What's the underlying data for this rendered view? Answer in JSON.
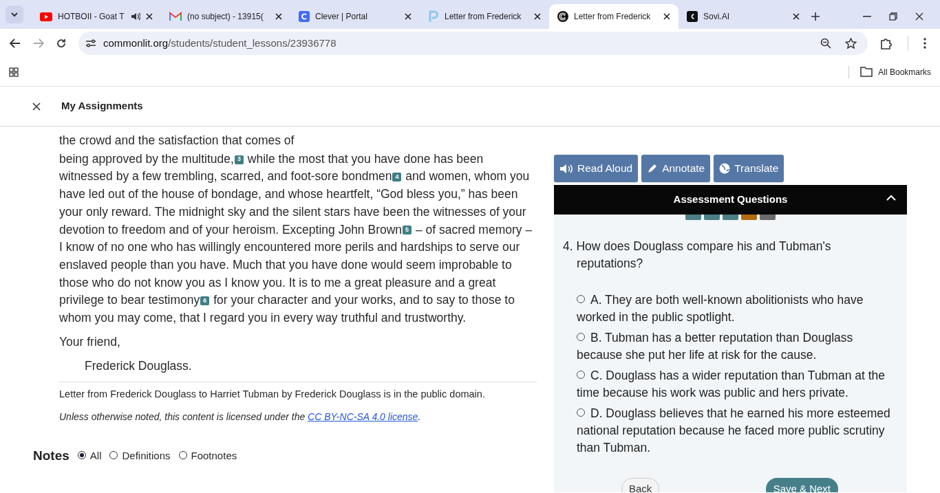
{
  "browser": {
    "tabs": [
      {
        "title": "HOTBOII - Goat T",
        "audio": true,
        "selected": false
      },
      {
        "title": "(no subject) - 13915(",
        "audio": false,
        "selected": false
      },
      {
        "title": "Clever | Portal",
        "audio": false,
        "selected": false
      },
      {
        "title": "Letter from Frederick",
        "audio": false,
        "selected": false
      },
      {
        "title": "Letter from Frederick",
        "audio": false,
        "selected": true
      },
      {
        "title": "Sovi.AI",
        "audio": false,
        "selected": false
      }
    ],
    "url_host": "commonlit.org",
    "url_path": "/students/student_lessons/23936778",
    "bookmarks_label": "All Bookmarks"
  },
  "header": {
    "title": "My Assignments"
  },
  "passage": {
    "lead_line": "the crowd and the satisfaction that comes of",
    "paragraph": [
      {
        "kind": "text",
        "text": "being approved by the multitude,"
      },
      {
        "kind": "footnote",
        "text": "3"
      },
      {
        "kind": "text",
        "text": " while the most that you have done has been witnessed by a few trembling, scarred, and foot-sore bondmen"
      },
      {
        "kind": "footnote",
        "text": "4"
      },
      {
        "kind": "text",
        "text": " and women, whom you have led out of the house of bondage, and whose heartfelt, “God bless you,” has been your only reward. The midnight sky and the silent stars have been the witnesses of your devotion to freedom and of your heroism. Excepting John Brown"
      },
      {
        "kind": "footnote",
        "text": "5"
      },
      {
        "kind": "text",
        "text": " – of sacred memory – I know of no one who has willingly encountered more perils and hardships to serve our enslaved people than you have. Much that you have done would seem improbable to those who do not know you as I know you. It is to me a great pleasure and a great privilege to bear testimony"
      },
      {
        "kind": "footnote",
        "text": "6"
      },
      {
        "kind": "text",
        "text": " for your character and your works, and to say to those to whom you may come, that I regard you in every way truthful and trustworthy."
      }
    ],
    "closing": "Your friend,",
    "signature": "Frederick Douglass.",
    "attribution": "Letter from Frederick Douglass to Harriet Tubman by Frederick Douglass is in the public domain.",
    "license_text": "Unless otherwise noted, this content is licensed under the",
    "license_link": "CC BY-NC-SA 4.0 license",
    "license_end": "."
  },
  "notes": {
    "title": "Notes",
    "filters": [
      {
        "label": "All",
        "selected": true
      },
      {
        "label": "Definitions",
        "selected": false
      },
      {
        "label": "Footnotes",
        "selected": false
      }
    ]
  },
  "tools": [
    {
      "label": "Read Aloud"
    },
    {
      "label": "Annotate"
    },
    {
      "label": "Translate"
    }
  ],
  "assessment": {
    "title": "Assessment Questions",
    "expanded": true,
    "question_tabs": [
      {
        "color": "#4a7f86"
      },
      {
        "color": "#4a7f86"
      },
      {
        "color": "#4a7f86"
      },
      {
        "color": "#b06b10"
      },
      {
        "color": "#6b6b6b"
      }
    ],
    "question": "4. How does Douglass compare his and Tubman's reputations?",
    "options": [
      {
        "text": "A. They are both well-known abolitionists who have worked in the public spotlight.",
        "selected": false
      },
      {
        "text": "B. Tubman has a better reputation than Douglass because she put her life at risk for the cause.",
        "selected": false
      },
      {
        "text": "C. Douglass has a wider reputation than Tubman at the time because his work was public and hers private.",
        "selected": false
      },
      {
        "text": "D. Douglass believes that he earned his more esteemed national reputation because he faced more public scrutiny than Tubman.",
        "selected": false
      }
    ],
    "back": "Back",
    "next": "Save & Next"
  }
}
